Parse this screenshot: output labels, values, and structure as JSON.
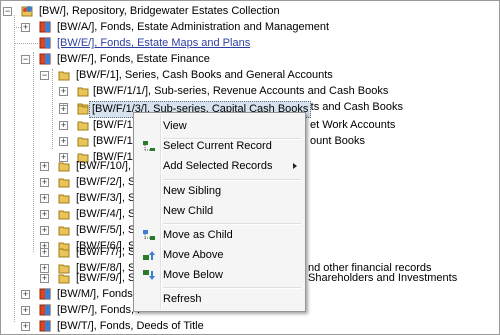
{
  "tree": {
    "rows": [
      {
        "text": "[BW/], Repository, Bridgewater Estates Collection",
        "icon": "repository-icon"
      },
      {
        "text": "[BW/A/], Fonds, Estate Administration and Management",
        "icon": "fonds-icon"
      },
      {
        "text": "[BW/E/], Fonds, Estate Maps and Plans",
        "icon": "fonds-icon"
      },
      {
        "text": "[BW/F/], Fonds, Estate Finance",
        "icon": "fonds-icon"
      },
      {
        "text": "[BW/F/1], Series, Cash Books and General Accounts",
        "icon": "folder-icon"
      },
      {
        "text": "[BW/F/1/1/], Sub-series, Revenue Accounts and Cash Books",
        "icon": "folder-icon"
      },
      {
        "text": "[BW/F/1/2/], Sub-series, Expenditure Accounts and Cash Books",
        "icon": "folder-icon"
      },
      {
        "text": "[BW/F/1/3/], Sub-series, Capital Cash Books",
        "icon": "folder-icon"
      },
      {
        "text": "[BW/F/1/4",
        "tail": "et Work Accounts",
        "icon": "folder-icon"
      },
      {
        "text": "[BW/F/1/5",
        "tail": "ount Books",
        "icon": "folder-icon"
      },
      {
        "text": "[BW/F/1/6",
        "icon": "folder-icon"
      },
      {
        "text": "[BW/F/10/], S",
        "icon": "folder-icon"
      },
      {
        "text": "[BW/F/2/], Se",
        "icon": "folder-icon"
      },
      {
        "text": "[BW/F/3/], Se",
        "icon": "folder-icon"
      },
      {
        "text": "[BW/F/4/], Se",
        "icon": "folder-icon"
      },
      {
        "text": "[BW/F/5/], Se",
        "icon": "folder-icon"
      },
      {
        "text": "[BW/F/6/], Se",
        "icon": "folder-icon"
      },
      {
        "text": "[BW/F/7/], Se",
        "icon": "folder-icon"
      },
      {
        "text": "[BW/F/8/], Se",
        "tail": "nd other financial records",
        "icon": "folder-icon"
      },
      {
        "text": "[BW/F/9/], Se",
        "tail": "Shareholders and Investments",
        "icon": "folder-icon"
      },
      {
        "text": "[BW/M/], Fonds, N",
        "icon": "fonds-icon"
      },
      {
        "text": "[BW/P/], Fonds, P",
        "icon": "fonds-icon"
      },
      {
        "text": "[BW/T/], Fonds, Deeds of Title",
        "icon": "fonds-icon"
      }
    ]
  },
  "context_menu": {
    "view": "View",
    "select_current_record": "Select Current Record",
    "add_selected_records": "Add Selected Records",
    "new_sibling": "New Sibling",
    "new_child": "New Child",
    "move_as_child": "Move as Child",
    "move_above": "Move Above",
    "move_below": "Move Below",
    "refresh": "Refresh"
  },
  "colors": {
    "selection": "#d6e2ee",
    "link_text": "#2f3f9e",
    "folder": "#e8c45a",
    "fonds": "#e0441f"
  }
}
